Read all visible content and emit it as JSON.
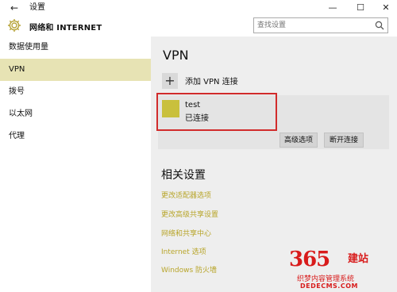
{
  "window": {
    "back_icon": "←",
    "title": "设置",
    "minimize": "—",
    "maximize": "☐",
    "close": "✕"
  },
  "header": {
    "app_title": "网络和 INTERNET",
    "search_placeholder": "查找设置"
  },
  "sidebar": {
    "items": [
      {
        "label": "数据使用量"
      },
      {
        "label": "VPN",
        "active": true
      },
      {
        "label": "拨号"
      },
      {
        "label": "以太网"
      },
      {
        "label": "代理"
      }
    ]
  },
  "vpn": {
    "heading": "VPN",
    "add_icon": "+",
    "add_label": "添加 VPN 连接",
    "connection": {
      "name": "test",
      "status": "已连接",
      "icon_color": "#c9c03c"
    },
    "advanced_button": "高级选项",
    "disconnect_button": "断开连接"
  },
  "related": {
    "heading": "相关设置",
    "links": [
      "更改适配器选项",
      "更改高级共享设置",
      "网络和共享中心",
      "Internet 选项",
      "Windows 防火墙"
    ]
  },
  "watermark": {
    "number": "365",
    "suffix": "建站",
    "line1": "织梦内容管理系统",
    "line2": "DEDECMS.COM"
  },
  "colors": {
    "accent": "#e7e3b4",
    "link": "#b8a52a",
    "highlight": "#d12b2b"
  }
}
